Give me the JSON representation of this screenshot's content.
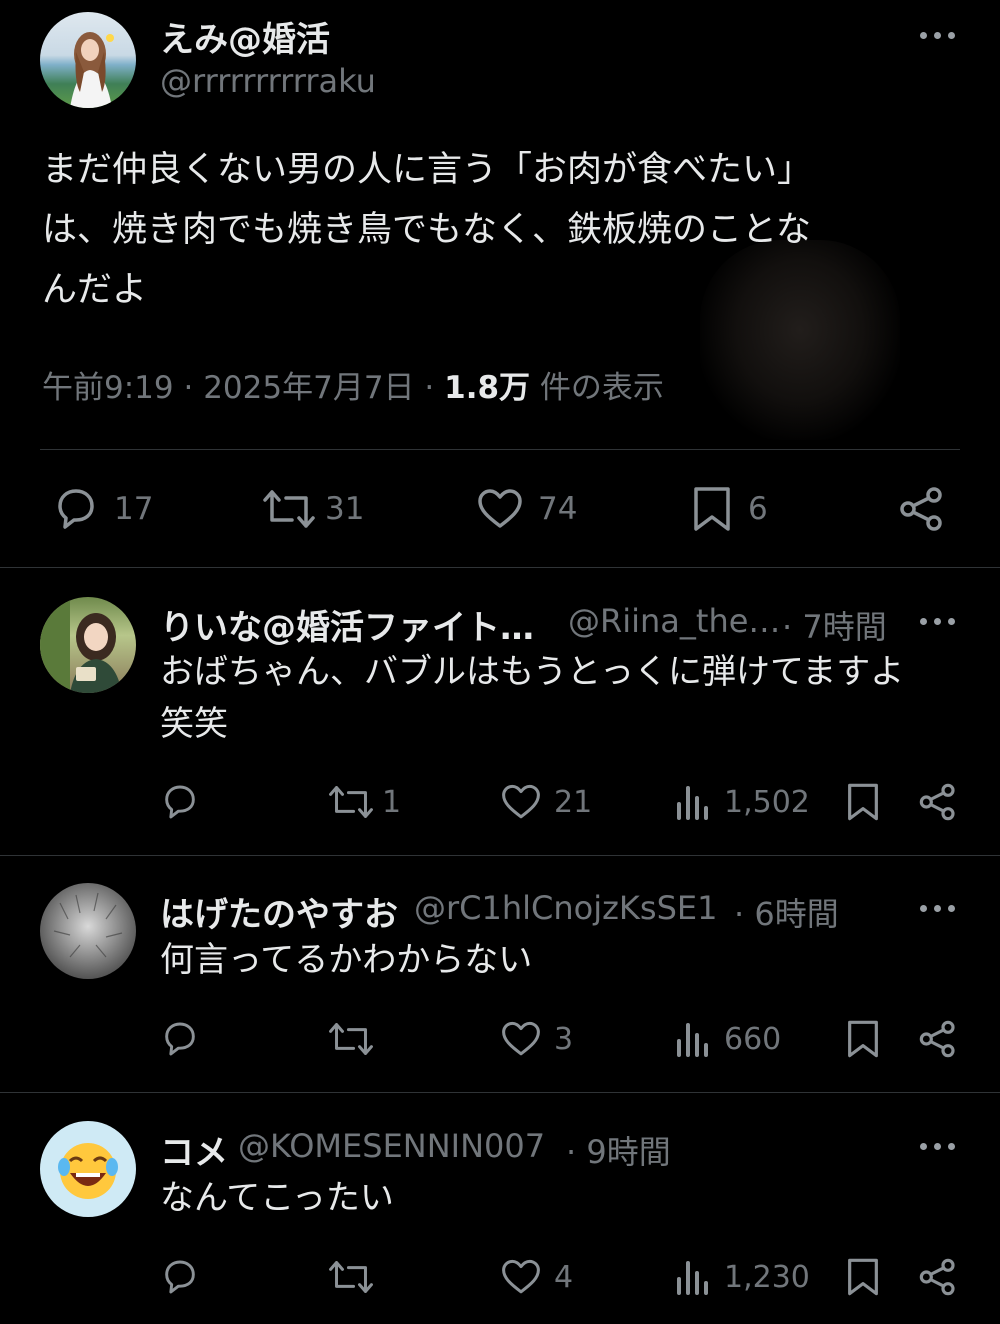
{
  "main_tweet": {
    "display_name": "えみ@婚活",
    "handle": "@rrrrrrrrrraku",
    "text_lines": [
      "まだ仲良くない男の人に言う「お肉が食べたい」",
      "は、焼き肉でも焼き鳥でもなく、鉄板焼のことな",
      "んだよ"
    ],
    "time": "午前9:19",
    "date": "2025年7月7日",
    "views_value": "1.8万",
    "views_label": "件の表示",
    "separator": "·",
    "stats": {
      "replies": "17",
      "retweets": "31",
      "likes": "74",
      "bookmarks": "6"
    }
  },
  "replies": [
    {
      "display_name": "りいな@婚活ファイト…",
      "handle": "@Riina_the…",
      "time": "· 7時間",
      "text_lines": [
        "おばちゃん、バブルはもうとっくに弾けてますよ",
        "笑笑"
      ],
      "retweets": "1",
      "likes": "21",
      "views": "1,502"
    },
    {
      "display_name": "はげたのやすお",
      "handle": "@rC1hlCnojzKsSE1",
      "time": "· 6時間",
      "text_lines": [
        "何言ってるかわからない"
      ],
      "retweets": "",
      "likes": "3",
      "views": "660"
    },
    {
      "display_name": "コメ",
      "handle": "@KOMESENNIN007",
      "time": "· 9時間",
      "text_lines": [
        "なんてこったい"
      ],
      "retweets": "",
      "likes": "4",
      "views": "1,230"
    }
  ],
  "colors": {
    "background": "#000000",
    "text": "#e7e9ea",
    "muted": "#71767b",
    "divider": "#2f3336"
  }
}
